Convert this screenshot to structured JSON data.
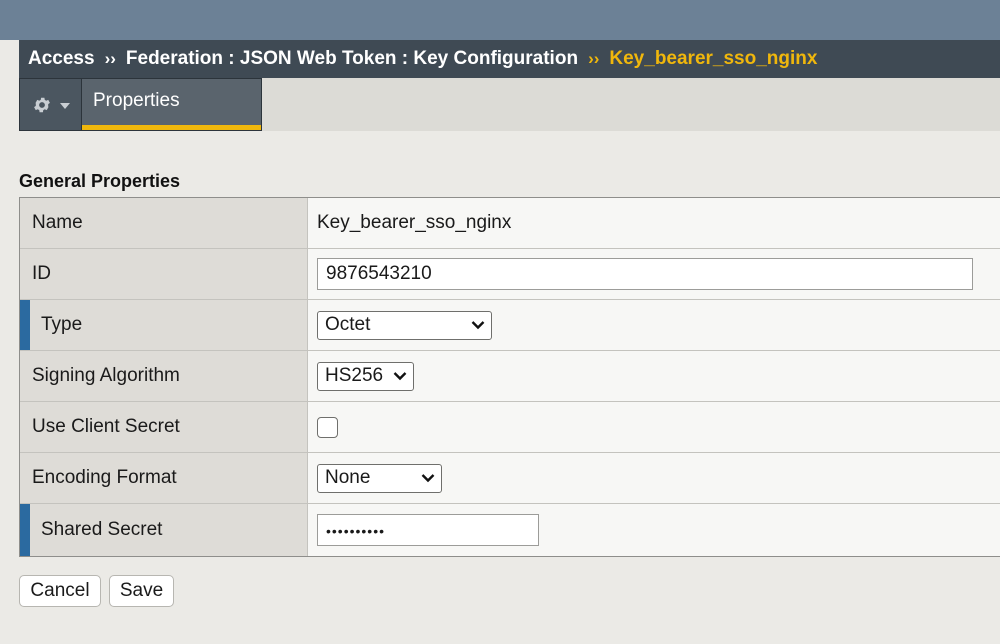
{
  "breadcrumb": {
    "items": [
      "Access",
      "Federation : JSON Web Token : Key Configuration"
    ],
    "separator": "››",
    "current": "Key_bearer_sso_nginx"
  },
  "tabs": {
    "settings_icon": "gear-icon",
    "items": [
      {
        "label": "Properties",
        "active": true
      }
    ]
  },
  "section": {
    "title": "General Properties"
  },
  "fields": {
    "name": {
      "label": "Name",
      "value": "Key_bearer_sso_nginx"
    },
    "id": {
      "label": "ID",
      "value": "9876543210"
    },
    "type": {
      "label": "Type",
      "value": "Octet",
      "required": true
    },
    "signing_algorithm": {
      "label": "Signing Algorithm",
      "value": "HS256"
    },
    "use_client_secret": {
      "label": "Use Client Secret",
      "checked": false
    },
    "encoding_format": {
      "label": "Encoding Format",
      "value": "None"
    },
    "shared_secret": {
      "label": "Shared Secret",
      "masked_value": "••••••••••",
      "required": true
    }
  },
  "buttons": {
    "cancel": "Cancel",
    "save": "Save"
  },
  "colors": {
    "accent": "#f0b70c",
    "required_marker": "#2b6aa0",
    "header_bg": "#3f4a54"
  }
}
